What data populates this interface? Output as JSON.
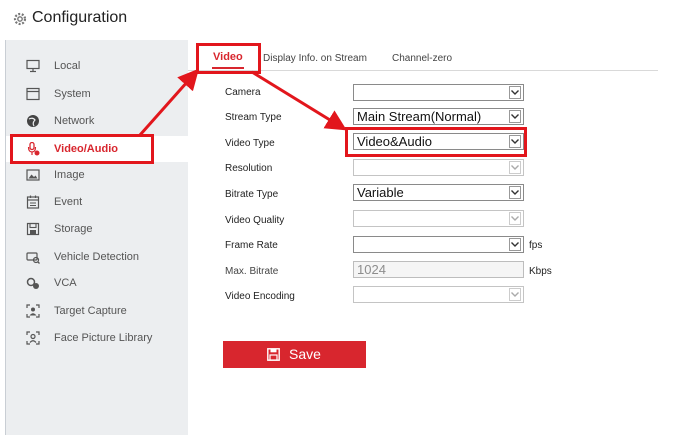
{
  "header": {
    "title": "Configuration",
    "icon": "gear-icon"
  },
  "sidebar": {
    "items": [
      {
        "label": "Local",
        "icon": "monitor-icon"
      },
      {
        "label": "System",
        "icon": "window-icon"
      },
      {
        "label": "Network",
        "icon": "globe-icon"
      },
      {
        "label": "Video/Audio",
        "icon": "video-audio-icon",
        "active": true
      },
      {
        "label": "Image",
        "icon": "image-icon"
      },
      {
        "label": "Event",
        "icon": "calendar-icon"
      },
      {
        "label": "Storage",
        "icon": "storage-icon"
      },
      {
        "label": "Vehicle Detection",
        "icon": "vehicle-icon"
      },
      {
        "label": "VCA",
        "icon": "vca-icon"
      },
      {
        "label": "Target Capture",
        "icon": "target-capture-icon"
      },
      {
        "label": "Face Picture Library",
        "icon": "face-library-icon"
      }
    ]
  },
  "tabs": [
    {
      "label": "Video",
      "active": true
    },
    {
      "label": "Display Info. on Stream"
    },
    {
      "label": "Channel-zero"
    }
  ],
  "form": {
    "camera": {
      "label": "Camera",
      "value": ""
    },
    "stream_type": {
      "label": "Stream Type",
      "value": "Main Stream(Normal)"
    },
    "video_type": {
      "label": "Video Type",
      "value": "Video&Audio"
    },
    "resolution": {
      "label": "Resolution",
      "value": ""
    },
    "bitrate_type": {
      "label": "Bitrate Type",
      "value": "Variable"
    },
    "video_quality": {
      "label": "Video Quality",
      "value": ""
    },
    "frame_rate": {
      "label": "Frame Rate",
      "value": "",
      "unit": "fps"
    },
    "max_bitrate": {
      "label": "Max. Bitrate",
      "value": "1024",
      "unit": "Kbps"
    },
    "video_encoding": {
      "label": "Video Encoding",
      "value": ""
    }
  },
  "save_label": "Save",
  "colors": {
    "accent": "#d8262e",
    "annotation": "#e2161c",
    "sidebar_bg": "#eceef0"
  }
}
